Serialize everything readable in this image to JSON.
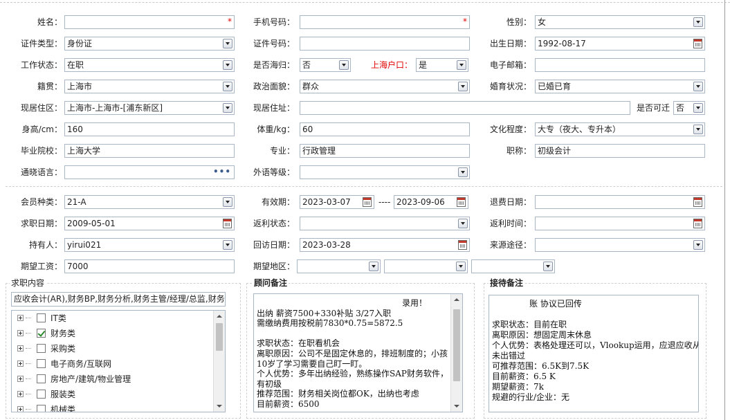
{
  "form": {
    "name": {
      "label": "姓名：",
      "value": "",
      "required_mark": "*"
    },
    "phone": {
      "label": "手机号码：",
      "value": "",
      "required_mark": "*"
    },
    "gender": {
      "label": "性别：",
      "value": "女"
    },
    "id_type": {
      "label": "证件类型：",
      "value": "身份证"
    },
    "id_number": {
      "label": "证件号码：",
      "value": ""
    },
    "birth_date": {
      "label": "出生日期：",
      "value": "1992-08-17"
    },
    "work_status": {
      "label": "工作状态：",
      "value": "在职"
    },
    "returnee": {
      "label": "是否海归：",
      "value": "否"
    },
    "shanghai_hukou": {
      "label": "上海户口：",
      "value": "是"
    },
    "email": {
      "label": "电子邮箱：",
      "value": ""
    },
    "native_place": {
      "label": "籍贯：",
      "value": "上海市"
    },
    "political_status": {
      "label": "政治面貌：",
      "value": "群众"
    },
    "marital_status": {
      "label": "婚育状况：",
      "value": "已婚已育"
    },
    "current_area": {
      "label": "现居住区：",
      "value": "上海市-上海市-[浦东新区]"
    },
    "current_address": {
      "label": "现居住址：",
      "value": ""
    },
    "can_relocate": {
      "label": "是否可迁",
      "value": "否"
    },
    "height": {
      "label": "身高/cm：",
      "value": "160"
    },
    "weight": {
      "label": "体重/kg：",
      "value": "60"
    },
    "education": {
      "label": "文化程度：",
      "value": "大专（夜大、专升本）"
    },
    "school": {
      "label": "毕业院校：",
      "value": "上海大学"
    },
    "major": {
      "label": "专业：",
      "value": "行政管理"
    },
    "title": {
      "label": "职称：",
      "value": "初级会计"
    },
    "languages": {
      "label": "通晓语言：",
      "value": "",
      "more_icon": "ellipsis-icon"
    },
    "foreign_level": {
      "label": "外语等级：",
      "value": ""
    }
  },
  "membership": {
    "member_type": {
      "label": "会员种类：",
      "value": "21-A"
    },
    "validity": {
      "label": "有效期：",
      "start": "2023-03-07",
      "separator": "----",
      "end": "2023-09-06"
    },
    "refund_date": {
      "label": "退费日期：",
      "value": ""
    },
    "job_seek_date": {
      "label": "求职日期：",
      "value": "2009-05-01"
    },
    "rebate_status": {
      "label": "返利状态：",
      "value": ""
    },
    "rebate_time": {
      "label": "返利时间：",
      "value": ""
    },
    "holder": {
      "label": "持有人：",
      "value": "yirui021"
    },
    "revisit_date": {
      "label": "回访日期：",
      "value": "2023-03-28"
    },
    "source": {
      "label": "来源途径：",
      "value": ""
    },
    "expected_salary": {
      "label": "期望工资：",
      "value": "7000"
    },
    "expected_region": {
      "label": "期望地区：",
      "values": [
        "",
        "",
        ""
      ]
    }
  },
  "job_content": {
    "title": "求职内容",
    "summary": "应收会计(AR),财务BP,财务分析,财务主管/经理/总监,财务",
    "tree": [
      {
        "label": "IT类",
        "checked": false
      },
      {
        "label": "财务类",
        "checked": true
      },
      {
        "label": "采购类",
        "checked": false
      },
      {
        "label": "电子商务/互联网",
        "checked": false
      },
      {
        "label": "房地产/建筑/物业管理",
        "checked": false
      },
      {
        "label": "服装类",
        "checked": false
      },
      {
        "label": "机械类",
        "checked": false
      }
    ]
  },
  "consultant_notes": {
    "title": "顾问备注",
    "lines": [
      "录用！",
      "出纳 薪资7500+330补贴 3/27入职",
      "需缴纳费用按税前7830*0.75=5872.5",
      "",
      "求职状态：在职看机会",
      "离职原因：公司不是固定休息的，排班制度的；小孩",
      "10岁了学习需要自己盯一盯。",
      "个人优势：多年出纳经验，熟练操作SAP财务软件，",
      "有初级",
      "推荐范围：财务相关岗位都OK，出纳也考虑",
      "目前薪资：6500"
    ]
  },
  "reception_notes": {
    "title": "接待备注",
    "lines": [
      "账 协议已回传",
      "",
      "求职状态：目前在职",
      "离职原因：想固定周末休息",
      "个人优势：表格处理还可以，Vlookup运用，应退应收从",
      "未出错过",
      "可推荐范围：6.5K到7.5K",
      "目前薪资：6.5 K",
      "期望薪资：7k",
      "规避的行业/企业：无"
    ]
  },
  "icons": {
    "dropdown": "chevron-down-icon",
    "calendar": "calendar-icon",
    "checkbox": "checkbox-icon",
    "expand": "plus-icon"
  }
}
